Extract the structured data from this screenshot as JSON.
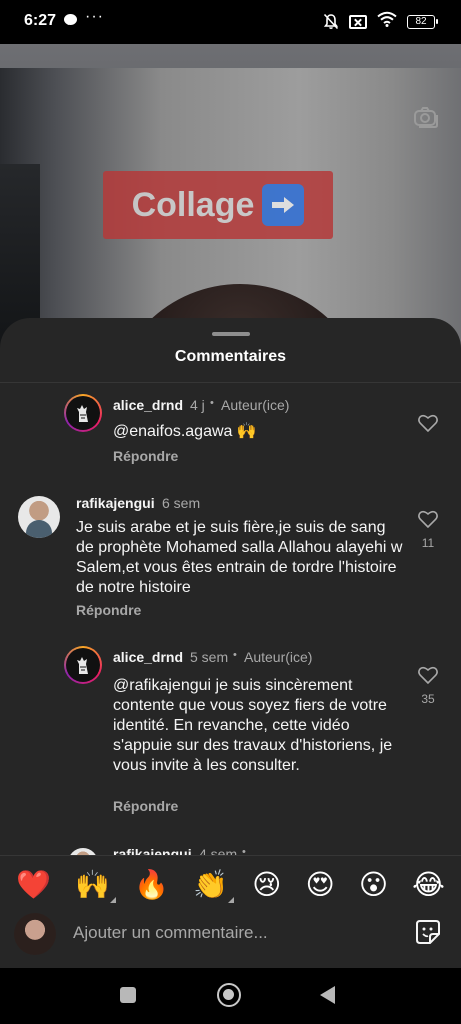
{
  "status_bar": {
    "time": "6:27",
    "more_glyph": "···",
    "battery": "82",
    "icons": [
      "chat-bubble-icon",
      "more-dots-icon",
      "mute-bell-icon",
      "sim-off-icon",
      "wifi-icon",
      "battery-icon"
    ]
  },
  "video": {
    "sticker_text": "Collage",
    "sticker_arrow": "➡",
    "camera_icon": "camera-icon"
  },
  "sheet": {
    "title": "Commentaires"
  },
  "comments": [
    {
      "username": "alice_drnd",
      "time": "4 j",
      "separator": "•",
      "badge": "Auteur(ice)",
      "text": "@enaifos.agawa 🙌",
      "reply_label": "Répondre",
      "likes": ""
    },
    {
      "username": "rafikajengui",
      "time": "6 sem",
      "text": "Je suis arabe et je suis fière,je suis de sang de prophète Mohamed salla Allahou alayehi w Salem,et vous êtes entrain de tordre l'histoire de notre histoire",
      "reply_label": "Répondre",
      "likes": "11"
    },
    {
      "username": "alice_drnd",
      "time": "5 sem",
      "separator": "•",
      "badge": "Auteur(ice)",
      "text": "@rafikajengui je suis sincèrement contente que vous soyez fiers de votre identité. En revanche, cette vidéo s'appuie sur des travaux d'historiens, je vous invite à les consulter.",
      "reply_label": "Répondre",
      "likes": "35"
    },
    {
      "username": "rafikajengui",
      "time": "4 sem",
      "separator": "•"
    }
  ],
  "emoji_bar": [
    "❤️",
    "🙌",
    "🔥",
    "👏",
    "😢",
    "😍",
    "😮",
    "😂"
  ],
  "composer": {
    "placeholder": "Ajouter un commentaire..."
  },
  "colors": {
    "sheet_bg": "#262626",
    "text_primary": "#f5f5f5",
    "text_secondary": "#a8a8a8",
    "sticker_red": "#b53a3a"
  }
}
